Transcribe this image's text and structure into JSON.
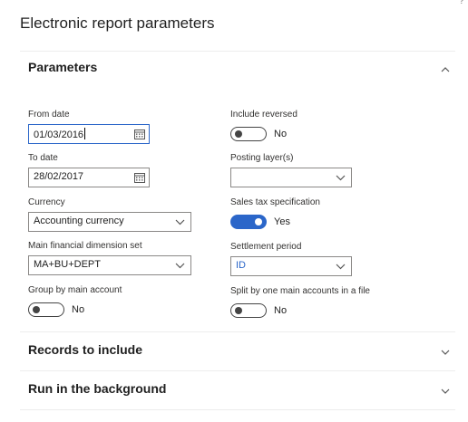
{
  "window": {
    "help_glyph": "?"
  },
  "dialog": {
    "title": "Electronic report parameters"
  },
  "parameters_section": {
    "title": "Parameters",
    "expanded": true,
    "left": {
      "from_date": {
        "label": "From date",
        "value": "01/03/2016",
        "icon": "calendar-icon"
      },
      "to_date": {
        "label": "To date",
        "value": "28/02/2017",
        "icon": "calendar-icon"
      },
      "currency": {
        "label": "Currency",
        "value": "Accounting currency"
      },
      "dimension_set": {
        "label": "Main financial dimension set",
        "value": "MA+BU+DEPT"
      },
      "group_by_main_account": {
        "label": "Group by main account",
        "state": "No",
        "on": false
      }
    },
    "right": {
      "include_reversed": {
        "label": "Include reversed",
        "state": "No",
        "on": false
      },
      "posting_layers": {
        "label": "Posting layer(s)",
        "value": ""
      },
      "sales_tax_spec": {
        "label": "Sales tax specification",
        "state": "Yes",
        "on": true
      },
      "settlement_period": {
        "label": "Settlement period",
        "value": "ID"
      },
      "split_by_main_account": {
        "label": "Split by one main accounts in a file",
        "state": "No",
        "on": false
      }
    }
  },
  "records_section": {
    "title": "Records to include",
    "expanded": false
  },
  "background_section": {
    "title": "Run in the background",
    "expanded": false
  },
  "colors": {
    "accent": "#2b66c9",
    "text": "#212121",
    "border": "#8a8886"
  }
}
